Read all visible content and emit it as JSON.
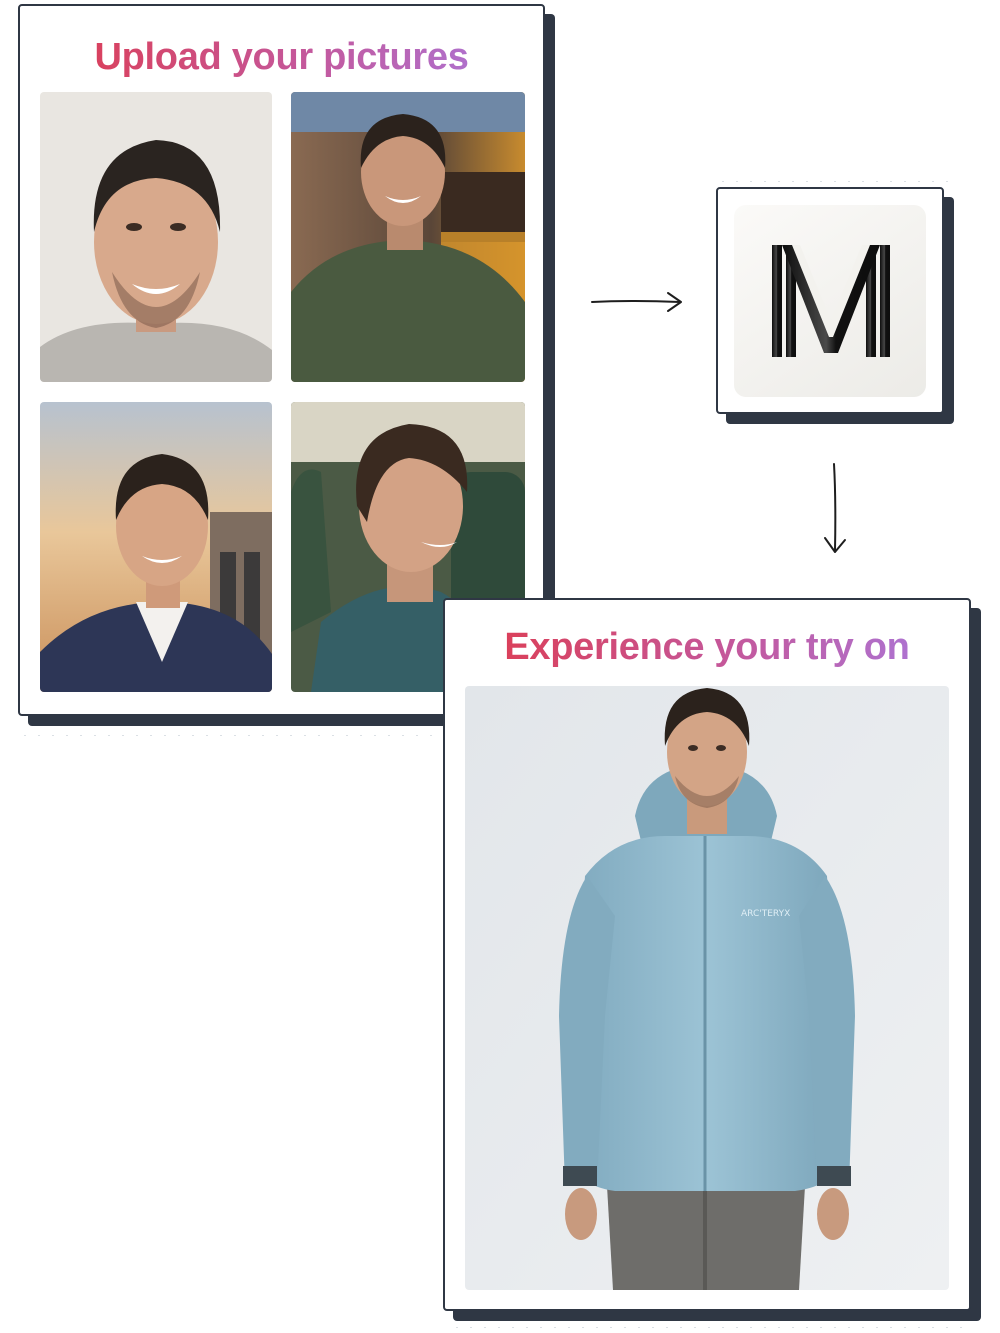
{
  "upload_card": {
    "title": "Upload your pictures",
    "photos": [
      {
        "icon": "portrait-photo",
        "scene": "plain wall, grey t-shirt"
      },
      {
        "icon": "portrait-photo",
        "scene": "bar at night, green jacket"
      },
      {
        "icon": "portrait-photo",
        "scene": "sunset, navy blazer"
      },
      {
        "icon": "portrait-photo",
        "scene": "train seat, profile, teal hoodie"
      }
    ]
  },
  "logo_card": {
    "logo_letter": "M",
    "icon": "m-logo-icon"
  },
  "result_card": {
    "title": "Experience your try on",
    "jacket_color": "#8fb8cc",
    "jacket_logo": "ARC'TERYX"
  },
  "colors": {
    "title_gradient_start": "#e03a4a",
    "title_gradient_end": "#a77ae0",
    "card_border": "#2f3744"
  }
}
